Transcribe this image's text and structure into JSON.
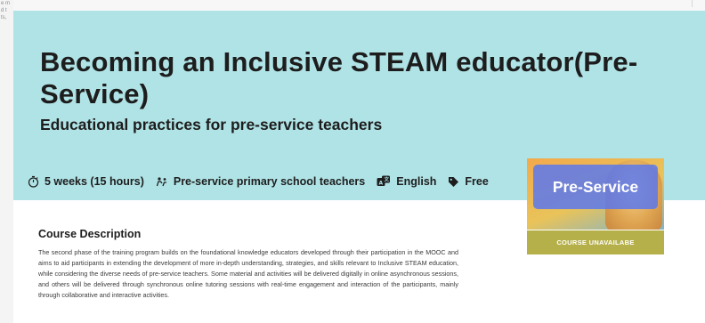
{
  "left_gutter": [
    "e m",
    "d t",
    "ts,"
  ],
  "hero": {
    "title": "Becoming an Inclusive STEAM educator(Pre-Service)",
    "subtitle": "Educational practices for pre-service teachers",
    "background_color": "#b0e3e6"
  },
  "meta": [
    {
      "icon": "stopwatch-icon",
      "label": "5 weeks (15 hours)"
    },
    {
      "icon": "people-icon",
      "label": "Pre-service primary school teachers"
    },
    {
      "icon": "language-icon",
      "label": "English"
    },
    {
      "icon": "price-tag-icon",
      "label": "Free"
    }
  ],
  "sidebar": {
    "badge_label": "Pre-Service",
    "badge_color": "#5c78ec",
    "button_label": "COURSE UNAVAILABE",
    "button_color": "#b6b04a"
  },
  "description": {
    "heading": "Course Description",
    "text": "The second phase of the training program builds on the foundational knowledge educators developed through their participation in the MOOC and aims to aid participants in extending the development of more in-depth understanding, strategies, and skills relevant to Inclusive STEAM education, while considering the diverse needs of pre-service teachers. Some material and activities will be delivered digitally in online asynchronous sessions, and others will be delivered through synchronous online tutoring sessions with real-time engagement and interaction of the participants, mainly through collaborative and interactive activities."
  }
}
